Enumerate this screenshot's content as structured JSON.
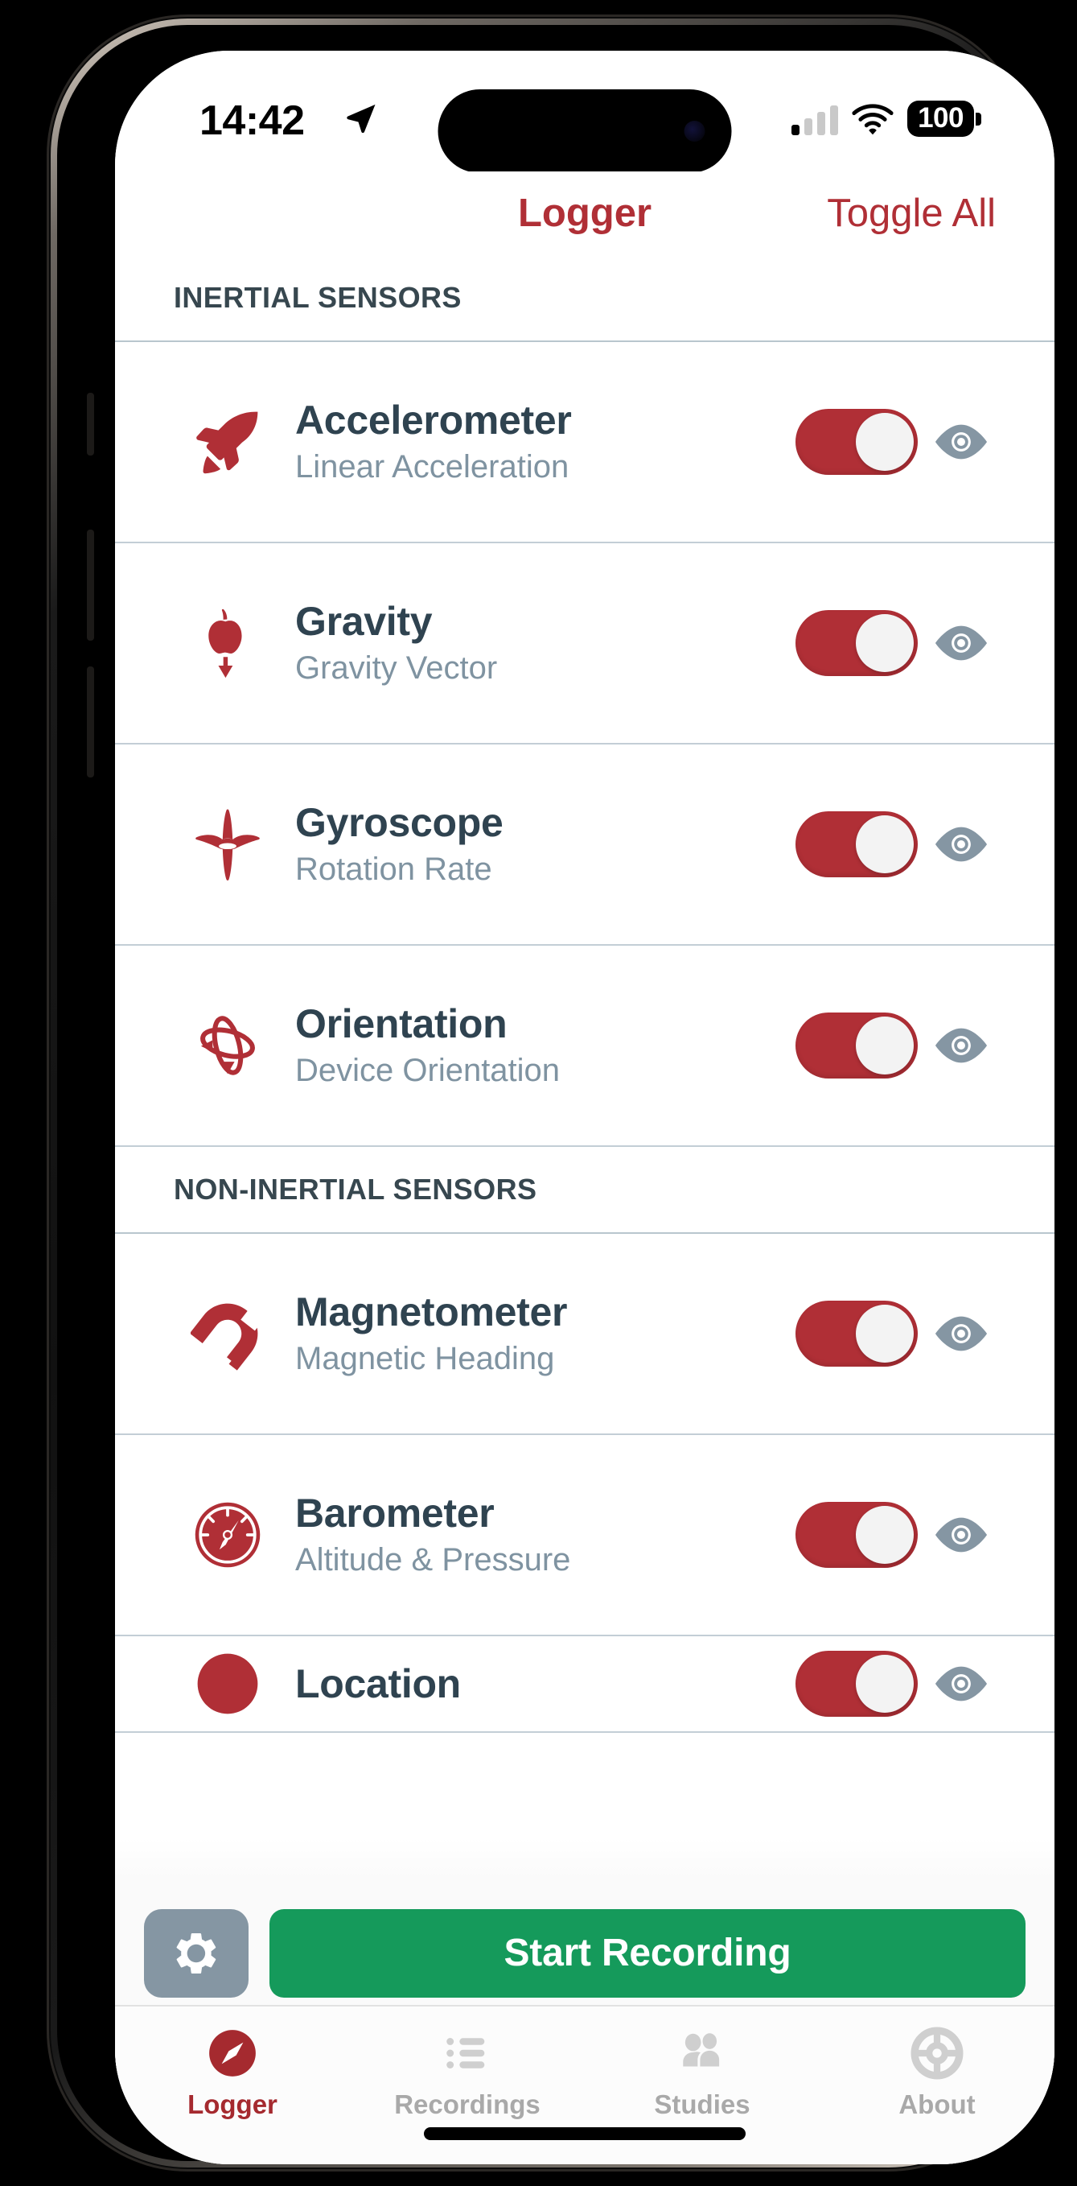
{
  "status_bar": {
    "time": "14:42",
    "location_icon": "location-arrow-icon",
    "cell_signal_icon": "cell-signal-icon",
    "cell_bars_filled": 1,
    "cell_bars_total": 4,
    "wifi_icon": "wifi-icon",
    "battery_level": "100",
    "battery_icon": "battery-icon"
  },
  "nav": {
    "title": "Logger",
    "toggle_all_label": "Toggle All"
  },
  "colors": {
    "accent_red": "#B02F36",
    "title_slate": "#2F4350",
    "subtitle_gray": "#7F93A1",
    "eye_gray": "#8596A3",
    "record_green": "#159A5B",
    "settings_gray": "#8596A3",
    "tab_inactive": "#A9A9A9",
    "tab_active": "#A52A2F"
  },
  "sections": [
    {
      "header": "INERTIAL SENSORS",
      "rows": [
        {
          "icon": "rocket-icon",
          "title": "Accelerometer",
          "subtitle": "Linear Acceleration",
          "toggle_on": true,
          "eye_icon": "eye-icon"
        },
        {
          "icon": "apple-fall-icon",
          "title": "Gravity",
          "subtitle": "Gravity Vector",
          "toggle_on": true,
          "eye_icon": "eye-icon"
        },
        {
          "icon": "spinning-top-icon",
          "title": "Gyroscope",
          "subtitle": "Rotation Rate",
          "toggle_on": true,
          "eye_icon": "eye-icon"
        },
        {
          "icon": "orbit-icon",
          "title": "Orientation",
          "subtitle": "Device Orientation",
          "toggle_on": true,
          "eye_icon": "eye-icon"
        }
      ]
    },
    {
      "header": "NON-INERTIAL SENSORS",
      "rows": [
        {
          "icon": "magnet-icon",
          "title": "Magnetometer",
          "subtitle": "Magnetic Heading",
          "toggle_on": true,
          "eye_icon": "eye-icon"
        },
        {
          "icon": "gauge-icon",
          "title": "Barometer",
          "subtitle": "Altitude & Pressure",
          "toggle_on": true,
          "eye_icon": "eye-icon"
        }
      ]
    }
  ],
  "action_bar": {
    "settings_icon": "gear-icon",
    "start_recording_label": "Start Recording"
  },
  "tab_bar": {
    "items": [
      {
        "label": "Logger",
        "icon": "compass-icon",
        "active": true
      },
      {
        "label": "Recordings",
        "icon": "list-icon",
        "active": false
      },
      {
        "label": "Studies",
        "icon": "people-icon",
        "active": false
      },
      {
        "label": "About",
        "icon": "life-ring-icon",
        "active": false
      }
    ]
  }
}
